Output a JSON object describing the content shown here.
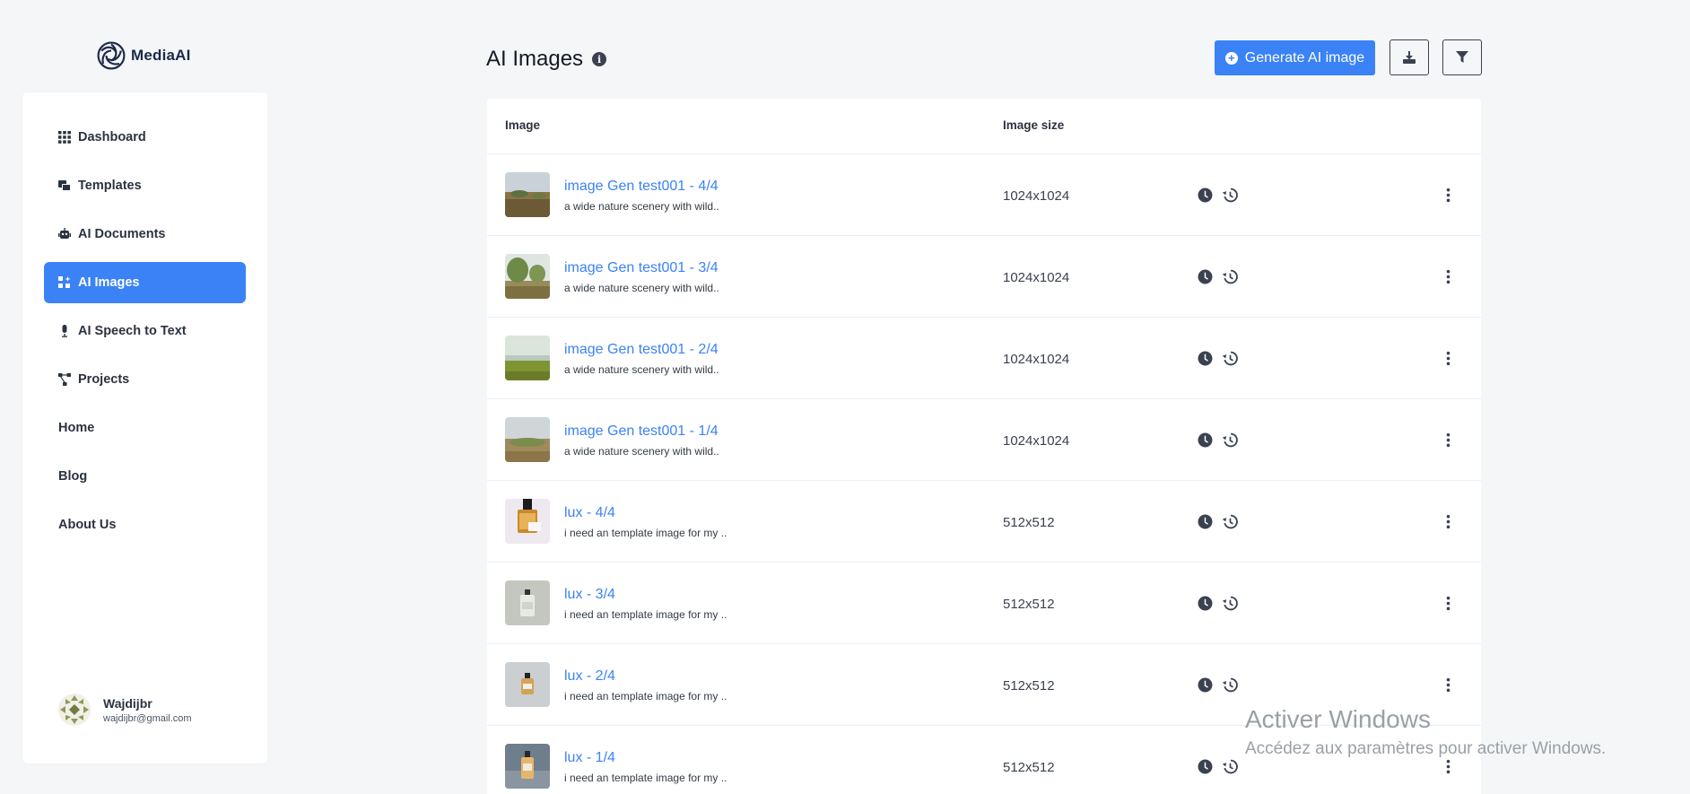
{
  "app": {
    "logo_text": "MediaAI"
  },
  "sidebar": {
    "items": [
      {
        "label": "Dashboard",
        "icon": "grid-icon"
      },
      {
        "label": "Templates",
        "icon": "templates-icon"
      },
      {
        "label": "AI Documents",
        "icon": "robot-icon"
      },
      {
        "label": "AI Images",
        "icon": "images-icon",
        "active": true
      },
      {
        "label": "AI Speech to Text",
        "icon": "microphone-icon"
      },
      {
        "label": "Projects",
        "icon": "projects-icon"
      },
      {
        "label": "Home"
      },
      {
        "label": "Blog"
      },
      {
        "label": "About Us"
      }
    ],
    "user": {
      "name": "Wajdijbr",
      "email": "wajdijbr@gmail.com"
    }
  },
  "header": {
    "title": "AI Images",
    "generate_label": "Generate AI image"
  },
  "table": {
    "columns": [
      "Image",
      "Image size"
    ],
    "rows": [
      {
        "title": "image Gen test001 - 4/4",
        "desc": "a wide nature scenery with wild..",
        "size": "1024x1024"
      },
      {
        "title": "image Gen test001 - 3/4",
        "desc": "a wide nature scenery with wild..",
        "size": "1024x1024"
      },
      {
        "title": "image Gen test001 - 2/4",
        "desc": "a wide nature scenery with wild..",
        "size": "1024x1024"
      },
      {
        "title": "image Gen test001 - 1/4",
        "desc": "a wide nature scenery with wild..",
        "size": "1024x1024"
      },
      {
        "title": "lux - 4/4",
        "desc": "i need an template image for my ..",
        "size": "512x512"
      },
      {
        "title": "lux - 3/4",
        "desc": "i need an template image for my ..",
        "size": "512x512"
      },
      {
        "title": "lux - 2/4",
        "desc": "i need an template image for my ..",
        "size": "512x512"
      },
      {
        "title": "lux - 1/4",
        "desc": "i need an template image for my ..",
        "size": "512x512"
      }
    ]
  },
  "watermark": {
    "title": "Activer Windows",
    "subtitle": "Accédez aux paramètres pour activer Windows."
  },
  "colors": {
    "accent": "#3b82f6",
    "background": "#f5f6f8",
    "text_dark": "#2b3340"
  }
}
